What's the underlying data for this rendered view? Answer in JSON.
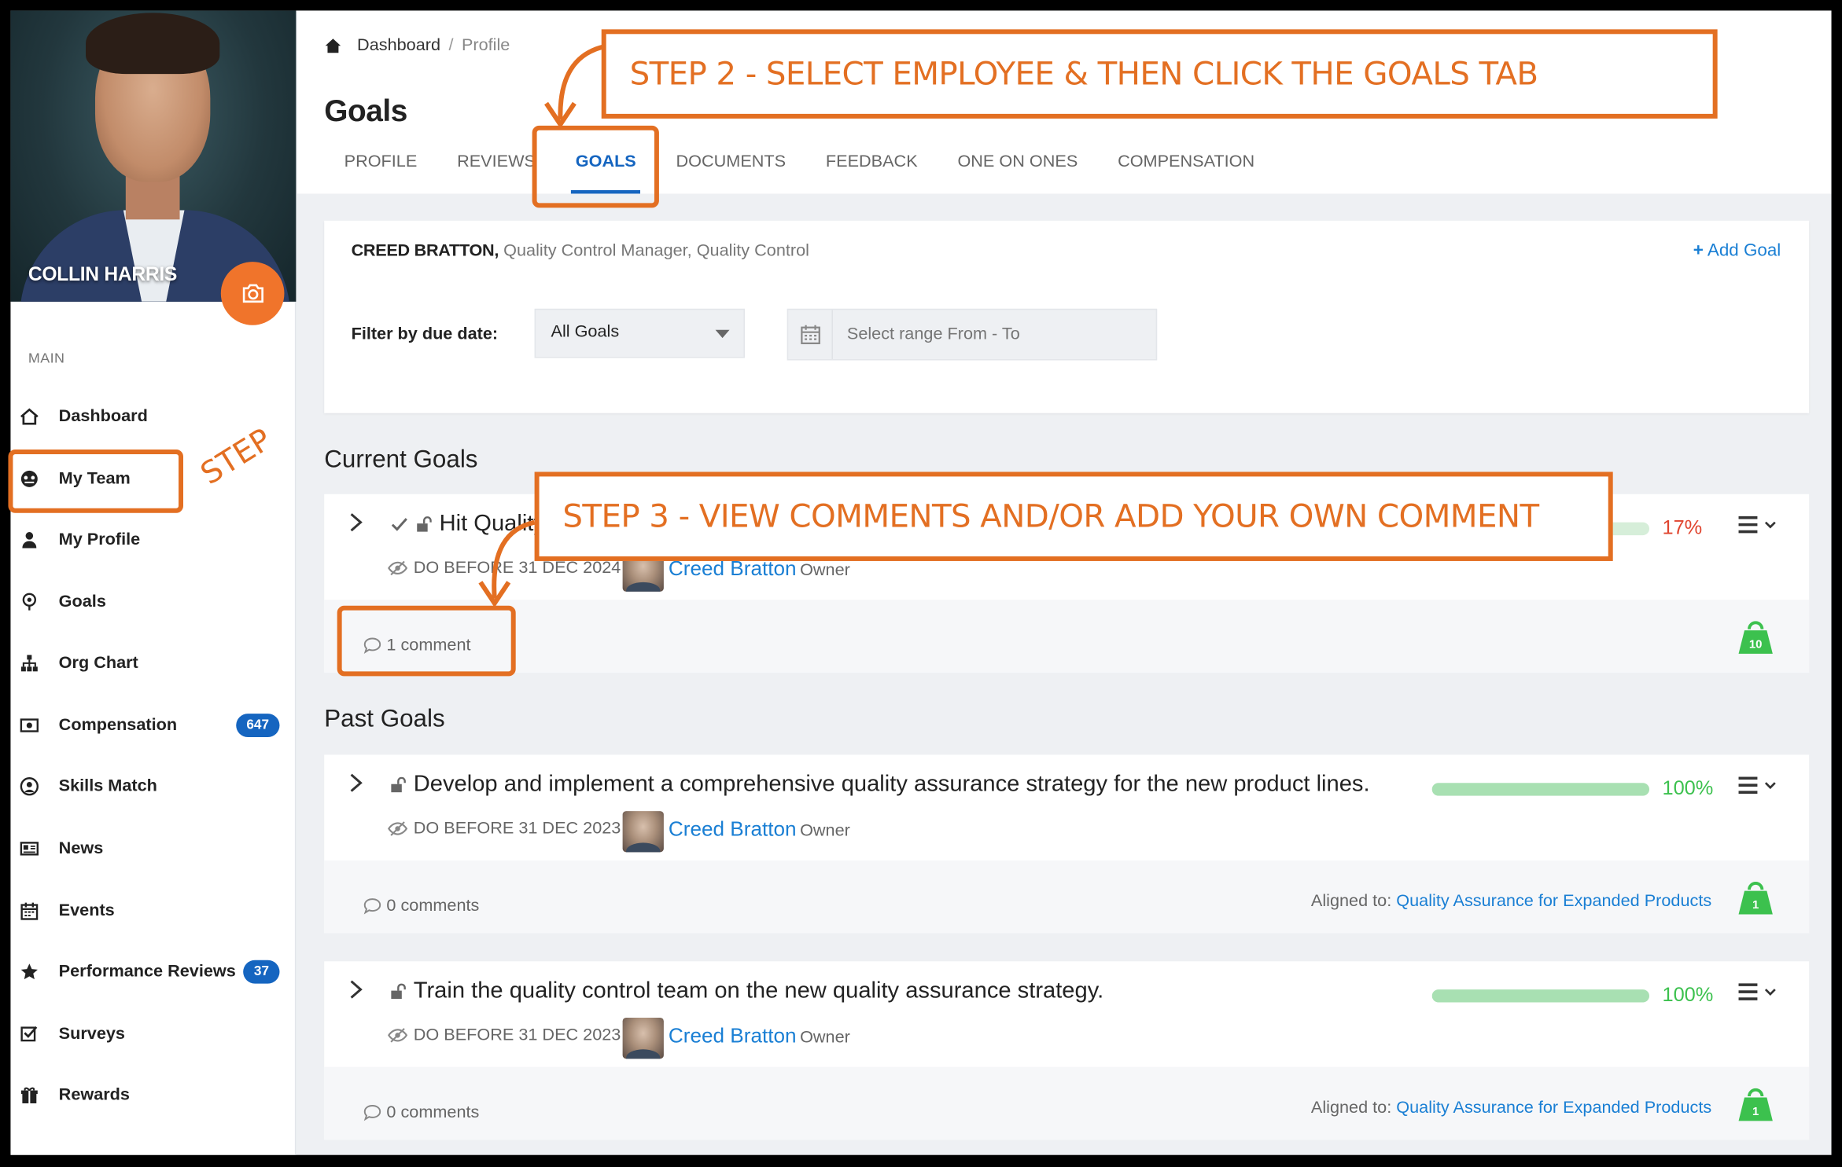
{
  "user": {
    "name": "COLLIN HARRIS"
  },
  "sidebar": {
    "section_label": "MAIN",
    "items": [
      {
        "label": "Dashboard",
        "icon": "home-icon"
      },
      {
        "label": "My Team",
        "icon": "team-icon"
      },
      {
        "label": "My Profile",
        "icon": "person-icon"
      },
      {
        "label": "Goals",
        "icon": "target-icon"
      },
      {
        "label": "Org Chart",
        "icon": "org-chart-icon"
      },
      {
        "label": "Compensation",
        "icon": "money-icon",
        "badge": "647"
      },
      {
        "label": "Skills Match",
        "icon": "skills-icon"
      },
      {
        "label": "News",
        "icon": "news-icon"
      },
      {
        "label": "Events",
        "icon": "calendar-icon"
      },
      {
        "label": "Performance Reviews",
        "icon": "star-icon",
        "badge": "37"
      },
      {
        "label": "Surveys",
        "icon": "checkbox-icon"
      },
      {
        "label": "Rewards",
        "icon": "gift-icon"
      }
    ]
  },
  "breadcrumb": {
    "home": "Dashboard",
    "separator": "/",
    "current": "Profile"
  },
  "page_title": "Goals",
  "tabs": [
    "PROFILE",
    "REVIEWS",
    "GOALS",
    "DOCUMENTS",
    "FEEDBACK",
    "ONE ON ONES",
    "COMPENSATION"
  ],
  "active_tab": "GOALS",
  "employee": {
    "name": "CREED BRATTON,",
    "role": "Quality Control Manager, Quality Control"
  },
  "add_goal_label": "Add Goal",
  "filter": {
    "label": "Filter by due date:",
    "select_value": "All Goals",
    "range_placeholder": "Select range From - To"
  },
  "current_goals": {
    "heading": "Current Goals",
    "items": [
      {
        "title": "Hit Quality",
        "due": "DO BEFORE 31 DEC 2024",
        "owner_name": "Creed Bratton",
        "owner_tag": "Owner",
        "progress": 17,
        "progress_label": "17%",
        "comments": "1 comment",
        "weight": "10"
      }
    ]
  },
  "past_goals": {
    "heading": "Past Goals",
    "items": [
      {
        "title": "Develop and implement a comprehensive quality assurance strategy for the new product lines.",
        "due": "DO BEFORE 31 DEC 2023",
        "owner_name": "Creed Bratton",
        "owner_tag": "Owner",
        "progress": 100,
        "progress_label": "100%",
        "comments": "0 comments",
        "aligned_label": "Aligned to:",
        "aligned_to": "Quality Assurance for Expanded Products",
        "weight": "1"
      },
      {
        "title": "Train the quality control team on the new quality assurance strategy.",
        "due": "DO BEFORE 31 DEC 2023",
        "owner_name": "Creed Bratton",
        "owner_tag": "Owner",
        "progress": 100,
        "progress_label": "100%",
        "comments": "0 comments",
        "aligned_label": "Aligned to:",
        "aligned_to": "Quality Assurance for Expanded Products",
        "weight": "1"
      }
    ]
  },
  "annotations": {
    "step1": "STEP",
    "step2": "STEP 2 - SELECT EMPLOYEE & THEN CLICK THE GOALS TAB",
    "step3": "STEP 3 - VIEW COMMENTS AND/OR ADD YOUR OWN COMMENT"
  },
  "colors": {
    "accent": "#1565c0",
    "link": "#1a7fd4",
    "annotation": "#e36f22",
    "camera": "#f0742b",
    "progress_low": "#e0452f",
    "progress_done": "#3cc14e"
  }
}
